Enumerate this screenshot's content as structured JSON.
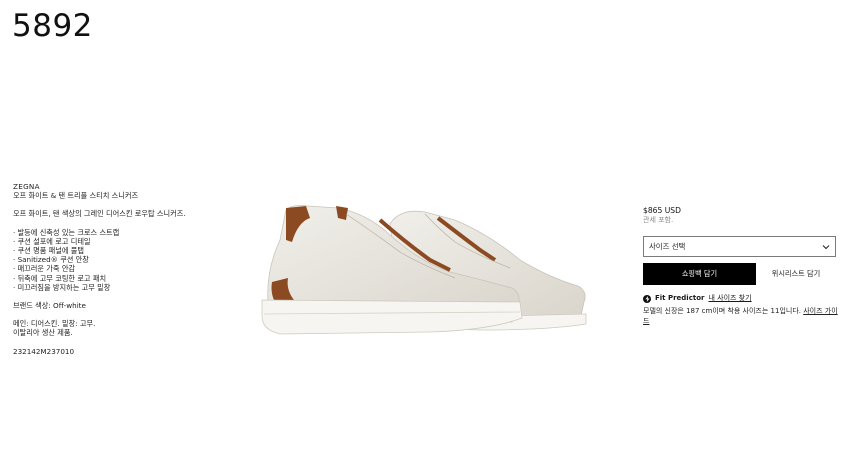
{
  "page": {
    "id_text": "5892"
  },
  "details": {
    "brand": "ZEGNA",
    "product_name": "오프 화이트 & 탠 트리플 스티치 스니커즈",
    "description": "오프 화이트, 탠 색상의 그레인 디어스킨 로우탑 스니커즈.",
    "features": [
      "· 발등에 신축성 있는 크로스 스트랩",
      "· 쿠션 설포에 로고 디테일",
      "· 쿠션 명품 패널에 풀탭",
      "· Sanitized® 쿠션 안창",
      "· 매끄러운 가죽 안감",
      "· 뒤축에 고무 코팅한 로고 패치",
      "· 미끄러짐을 방지하는 고무 밑창"
    ],
    "brand_color": "브랜드 색상: Off-white",
    "material_line1": "메인: 디어스킨. 밑창: 고무.",
    "material_line2": "이탈리아 생산 제품.",
    "sku": "232142M237010"
  },
  "purchase": {
    "price": "$865 USD",
    "tax_note": "관세 포함.",
    "size_select_label": "사이즈 선택",
    "add_to_bag_label": "쇼핑백 담기",
    "wishlist_label": "위시리스트 담기",
    "fit_predictor_label": "Fit Predictor",
    "find_size_link": "내 사이즈 찾기",
    "model_note": "모델의 신장은 187 cm이며 착용 사이즈는 11입니다. ",
    "size_guide_link": "사이즈 가이드"
  },
  "colors": {
    "accent": "#000000",
    "leather_tan": "#8b4a22",
    "shoe_white": "#e9e6df"
  },
  "icons": {
    "select_chevron": "chevron-down-icon",
    "fit_predictor": "fit-predictor-icon"
  }
}
